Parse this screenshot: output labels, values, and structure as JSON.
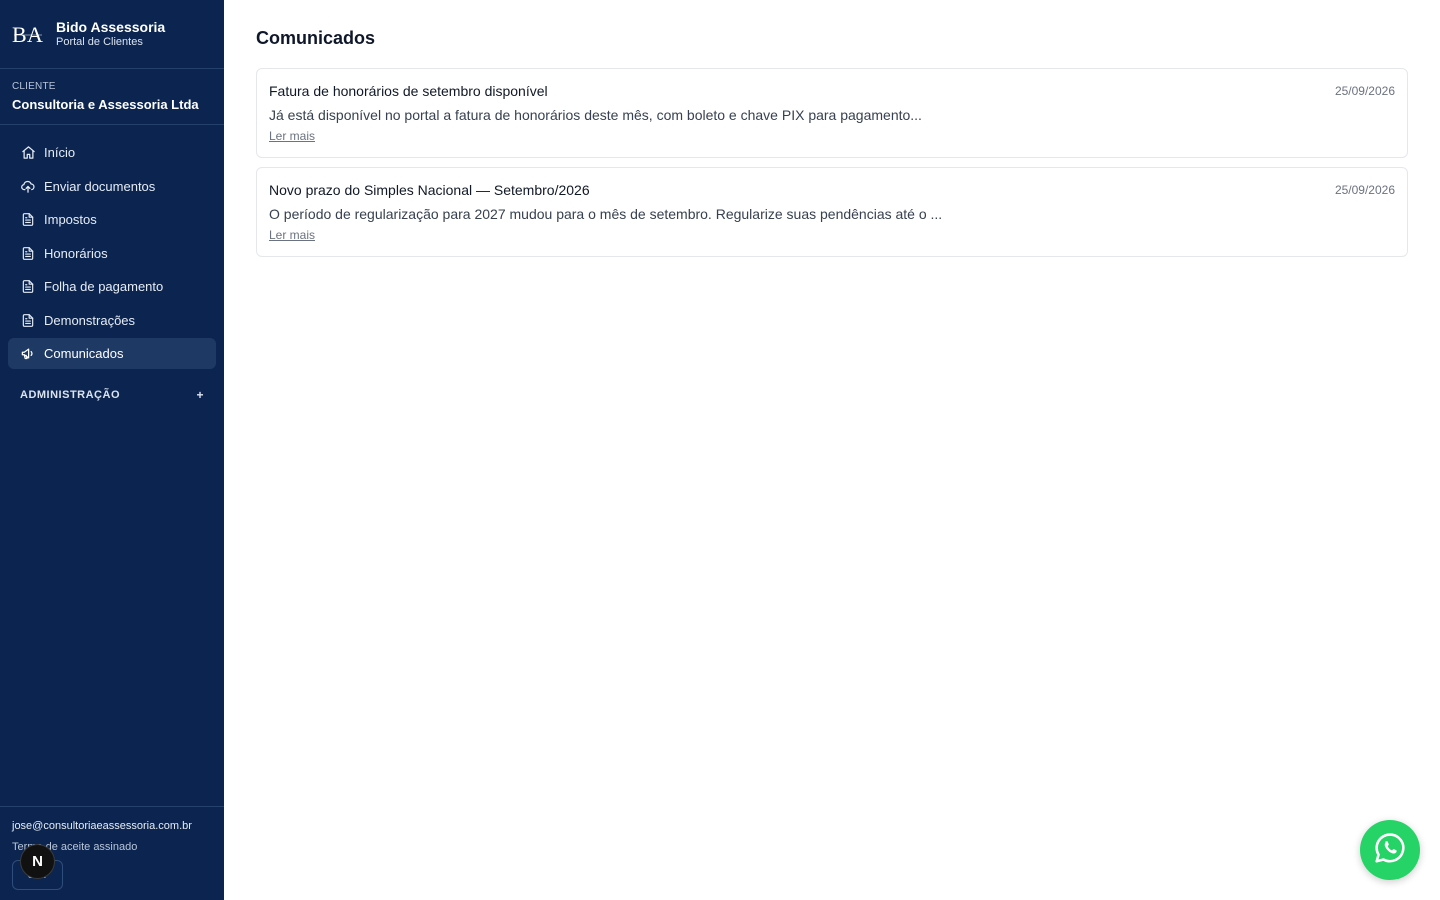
{
  "brand": {
    "logo": "BA",
    "name": "Bido Assessoria",
    "subtitle": "Portal de Clientes"
  },
  "client": {
    "label": "CLIENTE",
    "name": "Consultoria e Assessoria Ltda"
  },
  "sidebar": {
    "items": [
      {
        "label": "Início",
        "icon": "home-icon"
      },
      {
        "label": "Enviar documentos",
        "icon": "cloud-upload-icon"
      },
      {
        "label": "Impostos",
        "icon": "document-icon"
      },
      {
        "label": "Honorários",
        "icon": "document-icon"
      },
      {
        "label": "Folha de pagamento",
        "icon": "document-icon"
      },
      {
        "label": "Demonstrações",
        "icon": "document-icon"
      },
      {
        "label": "Comunicados",
        "icon": "megaphone-icon",
        "active": true
      }
    ],
    "admin_label": "ADMINISTRAÇÃO",
    "admin_toggle": "+"
  },
  "footer": {
    "email": "jose@consultoriaeassessoria.com.br",
    "terms": "Termo de aceite assinado",
    "button": "Sair",
    "badge": "N"
  },
  "main": {
    "title": "Comunicados",
    "items": [
      {
        "title": "Fatura de honorários de setembro disponível",
        "date": "25/09/2026",
        "body": "Já está disponível no portal a fatura de honorários deste mês, com boleto e chave PIX para pagamento...",
        "link": "Ler mais"
      },
      {
        "title": "Novo prazo do Simples Nacional — Setembro/2026",
        "date": "25/09/2026",
        "body": "O período de regularização para 2027 mudou para o mês de setembro. Regularize suas pendências até o ...",
        "link": "Ler mais"
      }
    ]
  },
  "colors": {
    "sidebar": "#0b2550",
    "active_item": "#1e3a64",
    "whatsapp": "#25d366"
  },
  "whatsapp_icon": "whatsapp-icon"
}
